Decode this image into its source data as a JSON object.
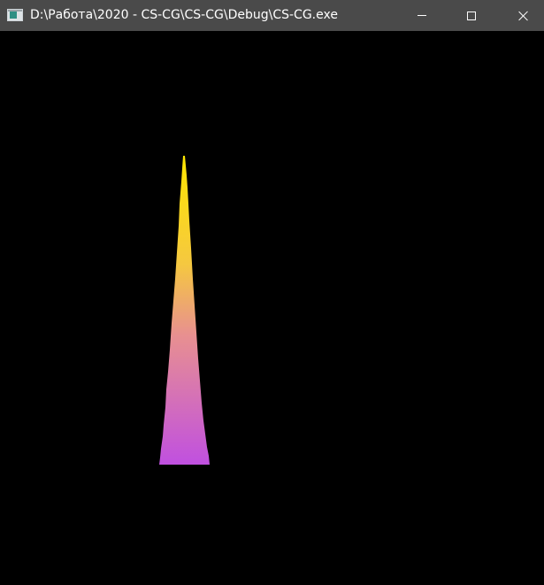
{
  "window": {
    "title": "D:\\Работа\\2020 - CS-CG\\CS-CG\\Debug\\CS-CG.exe",
    "icon": "console-app-icon",
    "controls": {
      "minimize_icon": "minimize-icon",
      "maximize_icon": "maximize-icon",
      "close_icon": "close-icon"
    }
  },
  "scene": {
    "shape": "gradient-cone",
    "background_color": "#000000",
    "colors": {
      "apex": "#ffe600",
      "middle": "#e89090",
      "base_left": "#ff00ff",
      "base_right": "#1000ff"
    }
  }
}
